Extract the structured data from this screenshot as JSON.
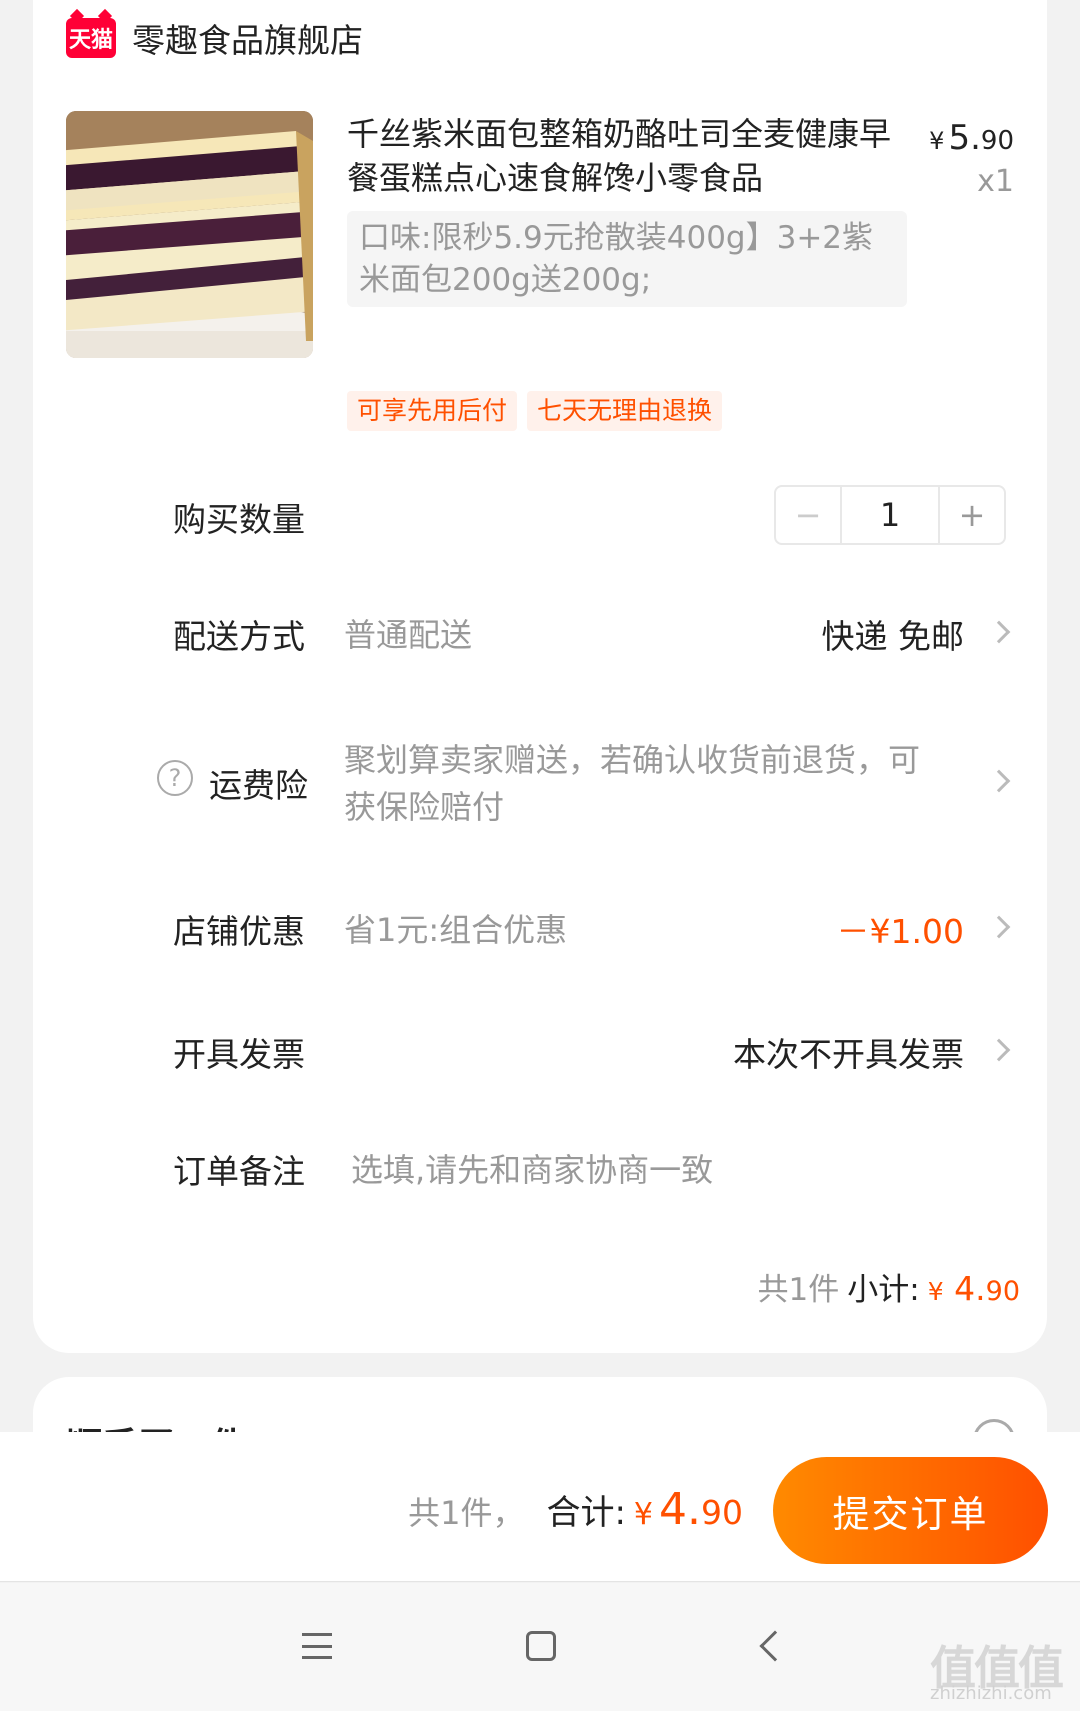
{
  "shop": {
    "logo_text": "天猫",
    "name": "零趣食品旗舰店"
  },
  "product": {
    "title": "千丝紫米面包整箱奶酪吐司全麦健康早餐蛋糕点心速食解馋小零食品",
    "price_symbol": "¥",
    "price_int": "5.",
    "price_dec": "90",
    "quantity_label": "x1",
    "spec": "口味:限秒5.9元抢散装400g】3+2紫米面包200g送200g;",
    "tags": [
      "可享先用后付",
      "七天无理由退换"
    ],
    "image_icon": "bread-sandwich-photo"
  },
  "rows": {
    "quantity": {
      "label": "购买数量",
      "minus": "−",
      "value": "1",
      "plus": "+"
    },
    "delivery": {
      "label": "配送方式",
      "sub": "普通配送",
      "value": "快递 免邮"
    },
    "insurance": {
      "label": "运费险",
      "sub_line1": "聚划算卖家赠送，若确认收货前退货，可",
      "sub_line2": "获保险赔付",
      "icon": "question-circle-icon"
    },
    "discount": {
      "label": "店铺优惠",
      "sub": "省1元:组合优惠",
      "value": "－¥1.00"
    },
    "invoice": {
      "label": "开具发票",
      "value": "本次不开具发票"
    },
    "note": {
      "label": "订单备注",
      "placeholder": "选填,请先和商家协商一致"
    }
  },
  "subtotal": {
    "count": "共1件",
    "label": "小计:",
    "symbol": "¥",
    "int": "4.",
    "dec": "90"
  },
  "next_card": {
    "title": "顺手买一件"
  },
  "bottom_bar": {
    "count": "共1件，",
    "label": "合计:",
    "symbol": "¥",
    "int": "4.",
    "dec": "90",
    "submit_label": "提交订单"
  },
  "watermark": {
    "text": "值值值",
    "url": "zhizhizhi.com"
  },
  "colors": {
    "accent": "#ff5000",
    "gradient_start": "#ff8a00",
    "tag_bg": "#fff1eb"
  }
}
